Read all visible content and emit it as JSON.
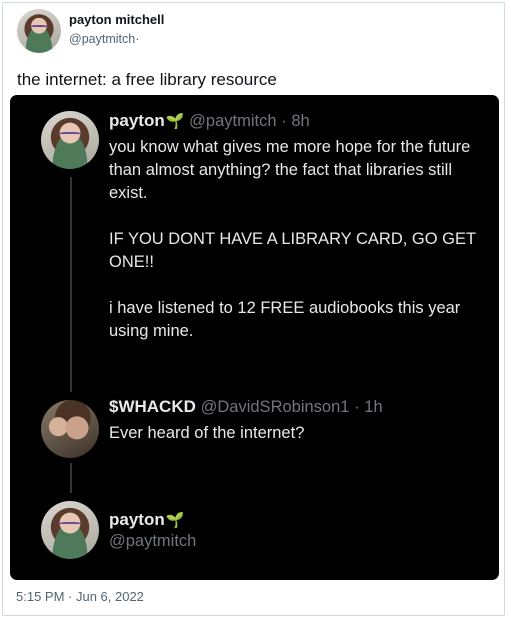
{
  "outer_tweet": {
    "name": "payton mitchell",
    "handle": "@paytmitch",
    "handle_suffix": "·",
    "text": "the internet: a free library resource",
    "timestamp": "5:15 PM · Jun 6, 2022"
  },
  "screenshot": {
    "tweet1": {
      "name": "payton",
      "name_emoji": "seedling-icon",
      "handle": "@paytmitch",
      "time": "· 8h",
      "paragraphs": [
        "you know what gives me more hope for the future than almost anything? the fact that libraries still exist.",
        "IF YOU DONT HAVE A LIBRARY CARD, GO GET ONE!!",
        "i have listened to 12 FREE audiobooks this year using mine."
      ]
    },
    "reply": {
      "name": "$WHACKD",
      "handle": "@DavidSRobinson1",
      "time": "· 1h",
      "text": "Ever heard of the internet?"
    },
    "reply_author": {
      "name": "payton",
      "name_emoji": "seedling-icon",
      "handle": "@paytmitch"
    }
  },
  "colors": {
    "dark_bg": "#000000",
    "dark_text": "#e7e9ea",
    "dark_muted": "#71767b",
    "leaf": "#00ba7c",
    "light_muted": "#536471"
  }
}
